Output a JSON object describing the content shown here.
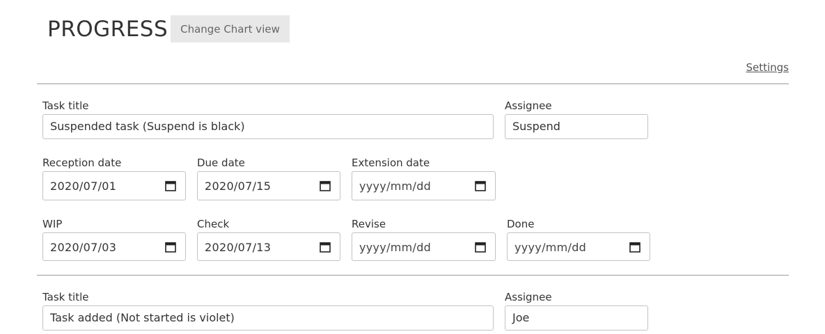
{
  "header": {
    "title": "PROGRESS",
    "chart_view_button": "Change Chart view",
    "settings_link": "Settings"
  },
  "task1": {
    "title_label": "Task title",
    "title_value": "Suspended task (Suspend is black)",
    "assignee_label": "Assignee",
    "assignee_value": "Suspend",
    "reception_label": "Reception date",
    "reception_value": "2020/07/01",
    "due_label": "Due date",
    "due_value": "2020/07/15",
    "extension_label": "Extension date",
    "extension_value": "yyyy/mm/dd",
    "wip_label": "WIP",
    "wip_value": "2020/07/03",
    "check_label": "Check",
    "check_value": "2020/07/13",
    "revise_label": "Revise",
    "revise_value": "yyyy/mm/dd",
    "done_label": "Done",
    "done_value": "yyyy/mm/dd"
  },
  "task2": {
    "title_label": "Task title",
    "title_value": "Task added (Not started is violet)",
    "assignee_label": "Assignee",
    "assignee_value": "Joe"
  },
  "icons": {
    "calendar": "calendar-icon"
  }
}
